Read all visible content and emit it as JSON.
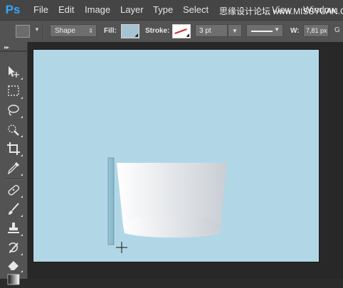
{
  "app": {
    "logo": "Ps",
    "menu": [
      "File",
      "Edit",
      "Image",
      "Layer",
      "Type",
      "Select",
      "View",
      "Window"
    ],
    "watermark": "思缘设计论坛 www.MISSYUAN.COM"
  },
  "options": {
    "tool_mode": "Shape",
    "fill_label": "Fill:",
    "fill_color": "#a6c3d4",
    "stroke_label": "Stroke:",
    "stroke_color": "none",
    "stroke_width": "3 pt",
    "width_label": "W:",
    "width_value": "7,81 px",
    "go_label": "G"
  },
  "tools": [
    "move-tool-icon",
    "rectangular-marquee-icon",
    "lasso-icon",
    "quick-selection-icon",
    "crop-icon",
    "eyedropper-icon",
    "spot-healing-brush-icon",
    "brush-icon",
    "clone-stamp-icon",
    "history-brush-icon",
    "eraser-icon",
    "gradient-icon"
  ],
  "canvas": {
    "background": "#b1d7e7",
    "cup_gradient_left": "#ffffff",
    "cup_gradient_right": "#c9ced4",
    "strip_color": "#8fbdd0",
    "cursor": "crosshair-icon"
  }
}
